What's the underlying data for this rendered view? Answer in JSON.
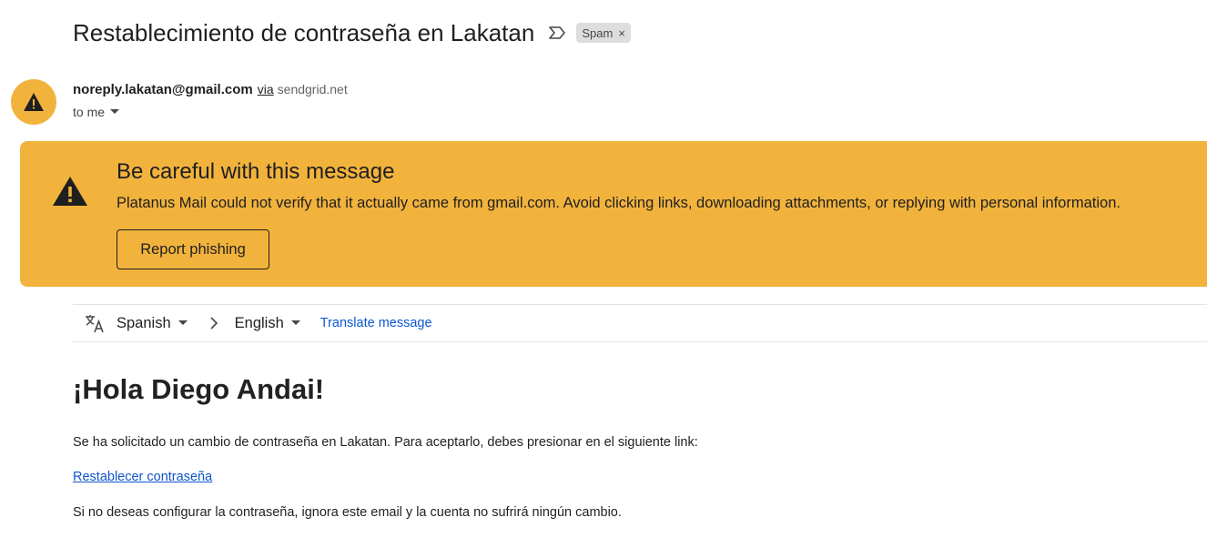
{
  "subject": {
    "title": "Restablecimiento de contraseña en Lakatan",
    "label": "Spam",
    "label_remove": "×"
  },
  "sender": {
    "email": "noreply.lakatan@gmail.com",
    "via_label": "via",
    "via_domain": "sendgrid.net",
    "to": "to me",
    "avatar_icon": "warning-icon"
  },
  "warning": {
    "title": "Be careful with this message",
    "description": "Platanus Mail could not verify that it actually came from gmail.com. Avoid clicking links, downloading attachments, or replying with personal information.",
    "button": "Report phishing",
    "color": "#f2b33d"
  },
  "translate": {
    "from_language": "Spanish",
    "to_language": "English",
    "action": "Translate message"
  },
  "body": {
    "greeting": "¡Hola Diego Andai!",
    "paragraph1": "Se ha solicitado un cambio de contraseña en Lakatan. Para aceptarlo, debes presionar en el siguiente link:",
    "link": "Restablecer contraseña",
    "paragraph2": "Si no deseas configurar la contraseña, ignora este email y la cuenta no sufrirá ningún cambio."
  }
}
